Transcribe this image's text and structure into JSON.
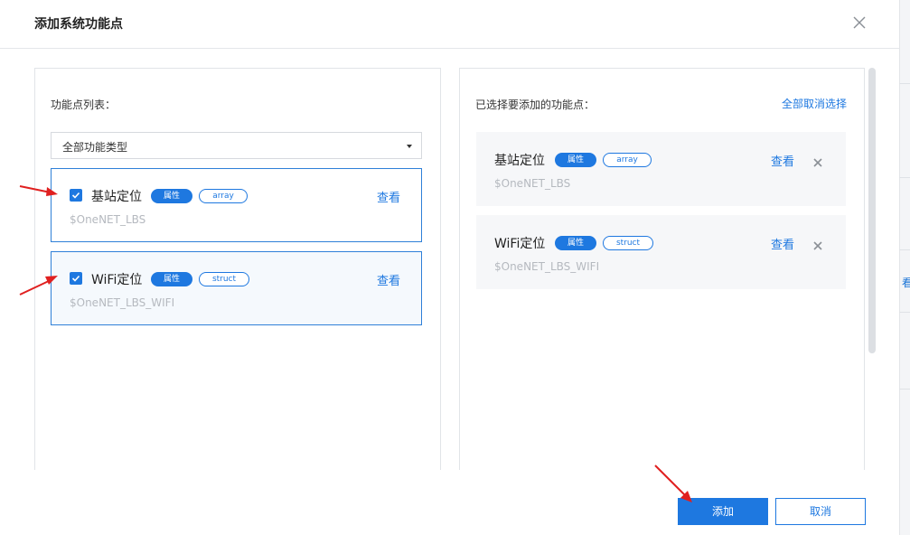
{
  "dialog": {
    "title": "添加系统功能点"
  },
  "left_panel": {
    "label": "功能点列表：",
    "filter_select": {
      "value": "全部功能类型"
    },
    "items": [
      {
        "name": "基站定位",
        "tag_type": "属性",
        "tag_data_type": "array",
        "identifier": "$OneNET_LBS",
        "view_label": "查看",
        "checked": true
      },
      {
        "name": "WiFi定位",
        "tag_type": "属性",
        "tag_data_type": "struct",
        "identifier": "$OneNET_LBS_WIFI",
        "view_label": "查看",
        "checked": true
      }
    ]
  },
  "right_panel": {
    "label": "已选择要添加的功能点：",
    "deselect_all_label": "全部取消选择",
    "items": [
      {
        "name": "基站定位",
        "tag_type": "属性",
        "tag_data_type": "array",
        "identifier": "$OneNET_LBS",
        "view_label": "查看"
      },
      {
        "name": "WiFi定位",
        "tag_type": "属性",
        "tag_data_type": "struct",
        "identifier": "$OneNET_LBS_WIFI",
        "view_label": "查看"
      }
    ]
  },
  "footer": {
    "add_label": "添加",
    "cancel_label": "取消"
  },
  "background_page": {
    "partial_text": "看"
  },
  "colors": {
    "accent": "#1e78e0",
    "annotation_arrow": "#e02020",
    "muted_text": "#b5b9bf"
  },
  "icons": [
    "close-icon",
    "check-icon",
    "caret-down-icon",
    "remove-icon"
  ]
}
